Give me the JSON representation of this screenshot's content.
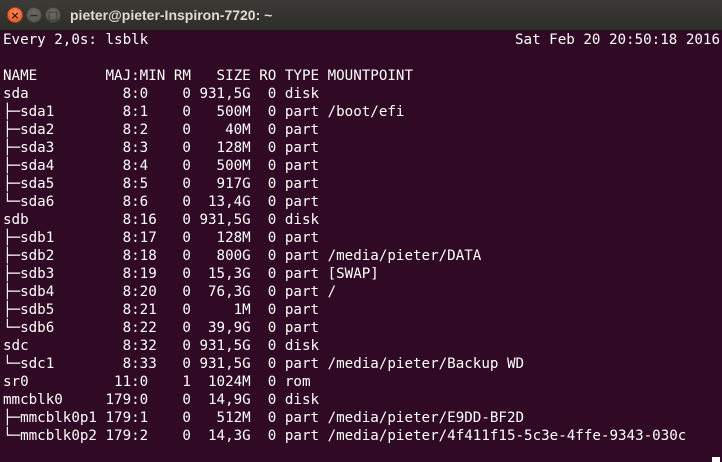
{
  "window": {
    "title": "pieter@pieter-Inspiron-7720: ~",
    "close_glyph": "×",
    "minimize_glyph": "−",
    "maximize_glyph": "□"
  },
  "terminal": {
    "watch_header": "Every 2,0s: lsblk",
    "timestamp": "Sat Feb 20 20:50:18 2016",
    "column_header": "NAME        MAJ:MIN RM   SIZE RO TYPE MOUNTPOINT",
    "rows": [
      "sda           8:0    0 931,5G  0 disk",
      "├─sda1        8:1    0   500M  0 part /boot/efi",
      "├─sda2        8:2    0    40M  0 part",
      "├─sda3        8:3    0   128M  0 part",
      "├─sda4        8:4    0   500M  0 part",
      "├─sda5        8:5    0   917G  0 part",
      "└─sda6        8:6    0  13,4G  0 part",
      "sdb           8:16   0 931,5G  0 disk",
      "├─sdb1        8:17   0   128M  0 part",
      "├─sdb2        8:18   0   800G  0 part /media/pieter/DATA",
      "├─sdb3        8:19   0  15,3G  0 part [SWAP]",
      "├─sdb4        8:20   0  76,3G  0 part /",
      "├─sdb5        8:21   0     1M  0 part",
      "└─sdb6        8:22   0  39,9G  0 part",
      "sdc           8:32   0 931,5G  0 disk",
      "└─sdc1        8:33   0 931,5G  0 part /media/pieter/Backup WD",
      "sr0          11:0    1  1024M  0 rom",
      "mmcblk0     179:0    0  14,9G  0 disk",
      "├─mmcblk0p1 179:1    0   512M  0 part /media/pieter/E9DD-BF2D",
      "└─mmcblk0p2 179:2    0  14,3G  0 part /media/pieter/4f411f15-5c3e-4ffe-9343-030c"
    ]
  }
}
